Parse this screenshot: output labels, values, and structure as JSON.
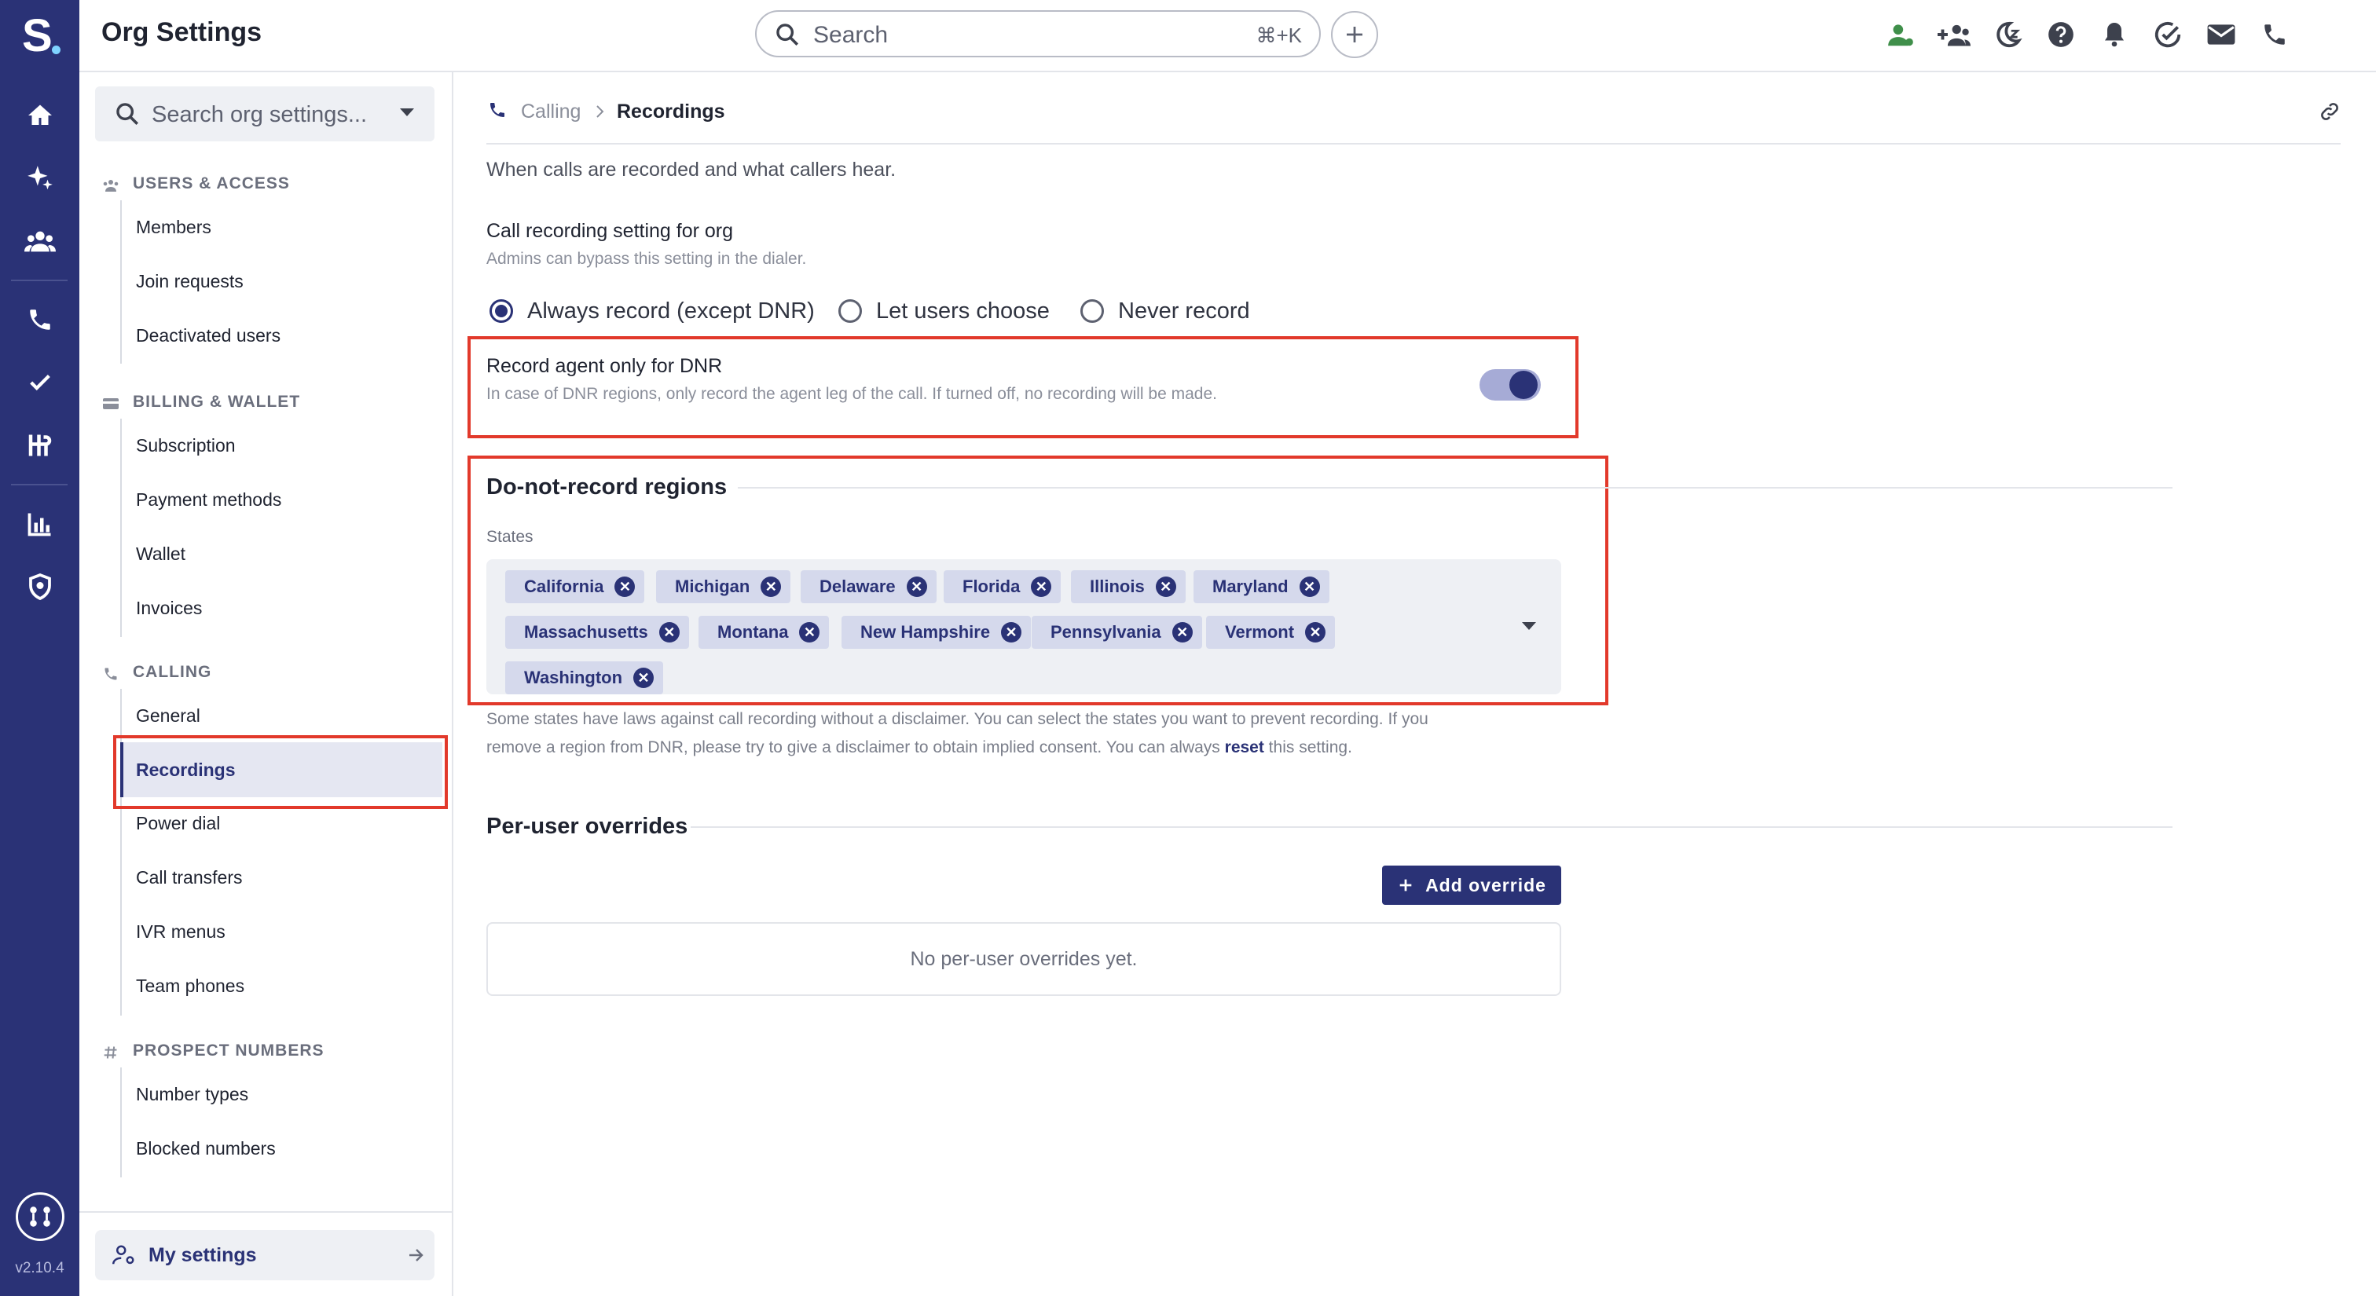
{
  "app": {
    "logo_letter": "S",
    "version": "v2.10.4"
  },
  "header": {
    "title": "Org Settings",
    "search_placeholder": "Search",
    "search_shortcut": "⌘+K"
  },
  "sidebar": {
    "search_placeholder": "Search org settings...",
    "sections": [
      {
        "title": "USERS & ACCESS",
        "items": [
          "Members",
          "Join requests",
          "Deactivated users"
        ]
      },
      {
        "title": "BILLING & WALLET",
        "items": [
          "Subscription",
          "Payment methods",
          "Wallet",
          "Invoices"
        ]
      },
      {
        "title": "CALLING",
        "items": [
          "General",
          "Recordings",
          "Power dial",
          "Call transfers",
          "IVR menus",
          "Team phones"
        ]
      },
      {
        "title": "PROSPECT NUMBERS",
        "items": [
          "Number types",
          "Blocked numbers"
        ]
      }
    ],
    "active_item": "Recordings",
    "my_settings_label": "My settings"
  },
  "main": {
    "breadcrumb": {
      "parent": "Calling",
      "current": "Recordings"
    },
    "description": "When calls are recorded and what callers hear.",
    "recording_setting": {
      "label": "Call recording setting for org",
      "sublabel": "Admins can bypass this setting in the dialer.",
      "options": [
        "Always record (except DNR)",
        "Let users choose",
        "Never record"
      ],
      "selected": "Always record (except DNR)"
    },
    "record_agent": {
      "label": "Record agent only for DNR",
      "sublabel": "In case of DNR regions, only record the agent leg of the call. If turned off, no recording will be made.",
      "enabled": true
    },
    "dnr": {
      "title": "Do-not-record regions",
      "states_label": "States",
      "states": [
        "California",
        "Michigan",
        "Delaware",
        "Florida",
        "Illinois",
        "Maryland",
        "Massachusetts",
        "Montana",
        "New Hampshire",
        "Pennsylvania",
        "Vermont",
        "Washington"
      ],
      "help_line1": "Some states have laws against call recording without a disclaimer. You can select the states you want to prevent recording. If you",
      "help_line2_pre": "remove a region from DNR, please try to give a disclaimer to obtain implied consent. You can always ",
      "help_link": "reset",
      "help_line2_post": " this setting."
    },
    "overrides": {
      "title": "Per-user overrides",
      "add_button": "Add override",
      "empty_text": "No per-user overrides yet."
    }
  },
  "colors": {
    "brand": "#2a3276",
    "highlight": "#e2392b",
    "accent_green": "#3f8f4a"
  }
}
